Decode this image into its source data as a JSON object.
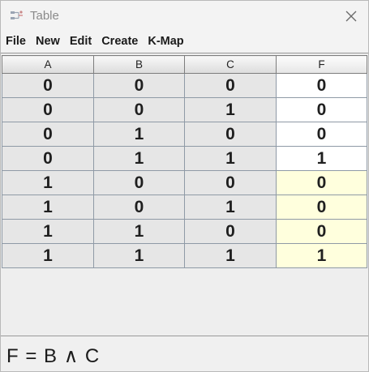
{
  "window": {
    "title": "Table",
    "icon": "table-app-icon",
    "close_icon": "close-icon"
  },
  "menu": [
    "File",
    "New",
    "Edit",
    "Create",
    "K-Map"
  ],
  "table": {
    "headers": [
      "A",
      "B",
      "C",
      "F"
    ],
    "rows": [
      [
        "0",
        "0",
        "0",
        "0"
      ],
      [
        "0",
        "0",
        "1",
        "0"
      ],
      [
        "0",
        "1",
        "0",
        "0"
      ],
      [
        "0",
        "1",
        "1",
        "1"
      ],
      [
        "1",
        "0",
        "0",
        "0"
      ],
      [
        "1",
        "0",
        "1",
        "0"
      ],
      [
        "1",
        "1",
        "0",
        "0"
      ],
      [
        "1",
        "1",
        "1",
        "1"
      ]
    ],
    "highlighted_rows": [
      4,
      5,
      6,
      7
    ],
    "highlight_color": "#ffffdd",
    "output_color": "#ffffff",
    "input_cell_color": "#e6e6e6"
  },
  "formula": "F = B ∧ C"
}
